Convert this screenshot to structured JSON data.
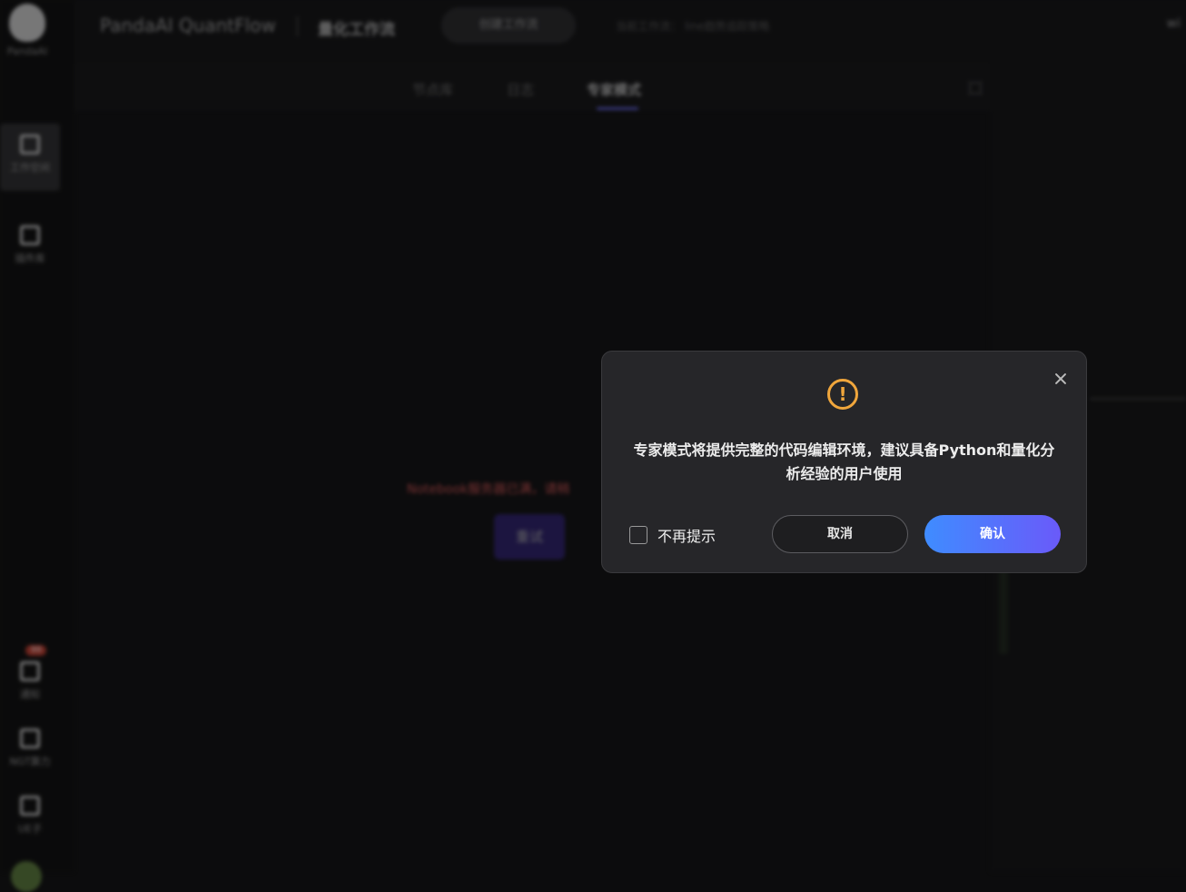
{
  "sidebar": {
    "logo_text": "PandaAI",
    "items": [
      {
        "label": "工作空间"
      },
      {
        "label": "插件库"
      },
      {
        "label": "通知",
        "badge": "99"
      },
      {
        "label": "NGT算力"
      },
      {
        "label": "UE子"
      }
    ]
  },
  "header": {
    "brand": "PandaAI QuantFlow",
    "subtitle": "量化工作流",
    "new_workflow": "创建工作流",
    "current_workflow": "当前工作流：  line趋势追踪策略",
    "user": "wi"
  },
  "tabs": [
    {
      "label": "节点库"
    },
    {
      "label": "日志"
    },
    {
      "label": "专家模式",
      "active": true
    }
  ],
  "main": {
    "error_text": "Notebook服务器已满，请稍",
    "retry_label": "重试"
  },
  "modal": {
    "message": "专家模式将提供完整的代码编辑环境，建议具备Python和量化分析经验的用户使用",
    "dont_show_label": "不再提示",
    "cancel_label": "取消",
    "confirm_label": "确认",
    "warning_glyph": "!"
  },
  "colors": {
    "accent_start": "#3f8cff",
    "accent_end": "#6a5af9",
    "warning": "#f0a63c",
    "modal_bg": "#262629"
  }
}
